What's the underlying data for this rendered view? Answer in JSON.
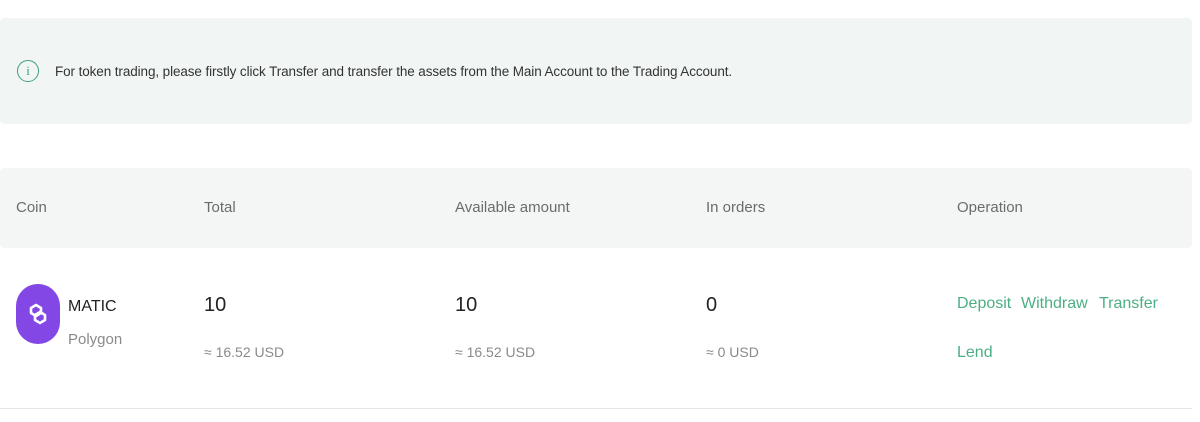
{
  "notice": {
    "icon": "info-icon",
    "icon_glyph": "i",
    "text": "For token trading, please firstly click Transfer and transfer the assets from the Main Account to the Trading Account."
  },
  "table": {
    "headers": {
      "coin": "Coin",
      "total": "Total",
      "available": "Available amount",
      "in_orders": "In orders",
      "operation": "Operation"
    },
    "rows": [
      {
        "logo": "polygon-logo",
        "symbol": "MATIC",
        "name": "Polygon",
        "total": "10",
        "total_usd": "≈ 16.52 USD",
        "available": "10",
        "available_usd": "≈ 16.52 USD",
        "in_orders": "0",
        "in_orders_usd": "≈ 0 USD",
        "operations": {
          "deposit": "Deposit",
          "withdraw": "Withdraw",
          "transfer": "Transfer",
          "lend": "Lend"
        }
      }
    ]
  },
  "colors": {
    "accent": "#4caf84",
    "polygon_brand": "#8247e5",
    "notice_bg": "#f1f6f4"
  }
}
